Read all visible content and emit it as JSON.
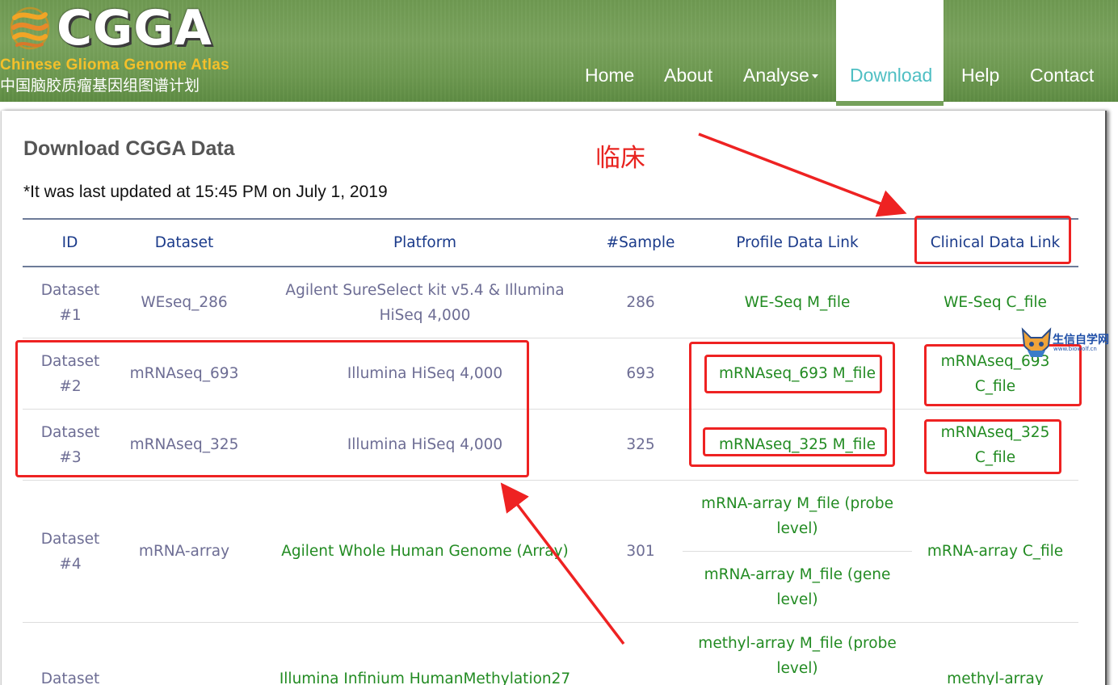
{
  "site": {
    "logo_text": "CGGA",
    "subtitle_en": "Chinese Glioma Genome Atlas",
    "subtitle_cn": "中国脑胶质瘤基因组图谱计划"
  },
  "nav": {
    "home": "Home",
    "about": "About",
    "analyse": "Analyse",
    "download": "Download",
    "help": "Help",
    "contact": "Contact",
    "active": "Download"
  },
  "page": {
    "title": "Download CGGA Data",
    "update_note": "*It was last updated at 15:45 PM on July 1, 2019"
  },
  "table": {
    "headers": [
      "ID",
      "Dataset",
      "Platform",
      "#Sample",
      "Profile Data Link",
      "Clinical Data Link"
    ],
    "rows": [
      {
        "id": "Dataset #1",
        "dataset": "WEseq_286",
        "platform": "Agilent SureSelect kit v5.4 & Illumina HiSeq 4,000",
        "samples": "286",
        "profile": [
          "WE-Seq M_file"
        ],
        "clinical": "WE-Seq C_file"
      },
      {
        "id": "Dataset #2",
        "dataset": "mRNAseq_693",
        "platform": "Illumina HiSeq 4,000",
        "samples": "693",
        "profile": [
          "mRNAseq_693 M_file"
        ],
        "clinical": "mRNAseq_693 C_file"
      },
      {
        "id": "Dataset #3",
        "dataset": "mRNAseq_325",
        "platform": "Illumina HiSeq 4,000",
        "samples": "325",
        "profile": [
          "mRNAseq_325 M_file"
        ],
        "clinical": "mRNAseq_325 C_file"
      },
      {
        "id": "Dataset #4",
        "dataset": "mRNA-array",
        "platform": "Agilent Whole Human Genome (Array)",
        "samples": "301",
        "profile": [
          "mRNA-array M_file (probe level)",
          "mRNA-array M_file (gene level)"
        ],
        "clinical": "mRNA-array C_file"
      },
      {
        "id": "Dataset",
        "dataset": "",
        "platform": "Illumina Infinium HumanMethylation27",
        "samples": "",
        "profile": [
          "methyl-array M_file (probe level)"
        ],
        "clinical": "methyl-array"
      }
    ]
  },
  "annotations": {
    "label_cn": "临床",
    "watermark": "生信自学网",
    "watermark_sub": "www.biowolf.cn",
    "color": "#ee2222"
  }
}
